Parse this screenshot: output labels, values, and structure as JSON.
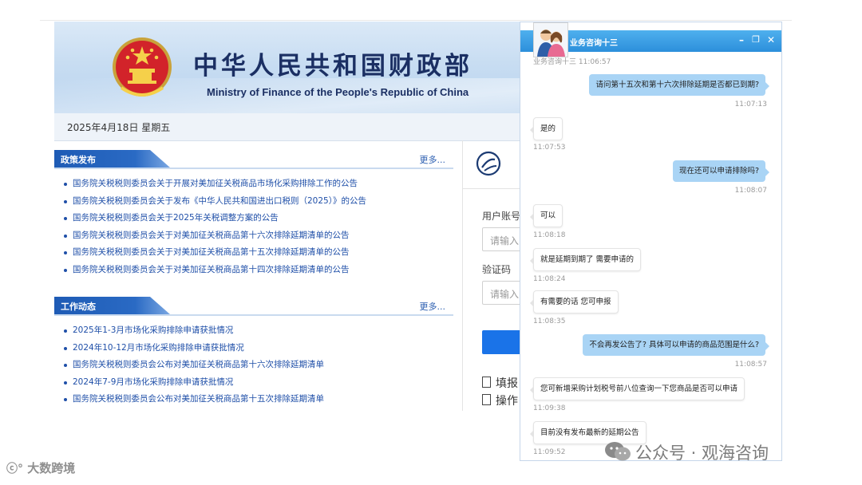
{
  "site": {
    "title_cn": "中华人民共和国财政部",
    "title_en": "Ministry of Finance of the People's Republic of China",
    "date": "2025年4月18日 星期五",
    "policy": {
      "title": "政策发布",
      "more": "更多...",
      "items": [
        "国务院关税税则委员会关于开展对美加征关税商品市场化采购排除工作的公告",
        "国务院关税税则委员会关于发布《中华人民共和国进出口税则（2025）》的公告",
        "国务院关税税则委员会关于2025年关税调整方案的公告",
        "国务院关税税则委员会关于对美加征关税商品第十六次排除延期清单的公告",
        "国务院关税税则委员会关于对美加征关税商品第十五次排除延期清单的公告",
        "国务院关税税则委员会关于对美加征关税商品第十四次排除延期清单的公告"
      ]
    },
    "work": {
      "title": "工作动态",
      "more": "更多...",
      "items": [
        "2025年1-3月市场化采购排除申请获批情况",
        "2024年10-12月市场化采购排除申请获批情况",
        "国务院关税税则委员会公布对美加征关税商品第十六次排除延期清单",
        "2024年7-9月市场化采购排除申请获批情况",
        "国务院关税税则委员会公布对美加征关税商品第十五次排除延期清单"
      ]
    },
    "login": {
      "account_label": "用户账号",
      "account_placeholder": "请输入",
      "captcha_label": "验证码",
      "captcha_placeholder": "请输入",
      "link1": "填报",
      "link2": "操作"
    }
  },
  "chat": {
    "title": "业务咨询十三",
    "controls": {
      "minimize": "–",
      "restore": "❐",
      "close": "✕"
    },
    "messages": [
      {
        "dir": "in",
        "sender": "业务咨询十三",
        "time": "11:06:57",
        "text": ""
      },
      {
        "dir": "out",
        "time": "11:07:13",
        "text": "请问第十五次和第十六次排除延期是否都已到期?"
      },
      {
        "dir": "in",
        "time": "11:07:53",
        "text": "是的"
      },
      {
        "dir": "out",
        "time": "11:08:07",
        "text": "现在还可以申请排除吗?"
      },
      {
        "dir": "in",
        "time": "11:08:18",
        "text": "可以"
      },
      {
        "dir": "in",
        "time": "11:08:24",
        "text": "就是延期到期了 需要申请的"
      },
      {
        "dir": "in",
        "time": "11:08:35",
        "text": "有需要的话 您可申报"
      },
      {
        "dir": "out",
        "time": "11:08:57",
        "text": "不会再发公告了? 具体可以申请的商品范围是什么?"
      },
      {
        "dir": "in",
        "time": "11:09:38",
        "text": "您可新增采购计划税号前八位查询一下您商品是否可以申请"
      },
      {
        "dir": "in",
        "time": "11:09:52",
        "text": "目前没有发布最新的延期公告"
      }
    ]
  },
  "watermarks": {
    "left": "大数跨境",
    "right": "公众号 · 观海咨询"
  },
  "colors": {
    "banner_blue": "#1b2f63",
    "section_tab": "#1e5bb5",
    "link": "#1f4fa8",
    "chat_header": "#2c8fdb",
    "out_bubble": "#a9d4f5",
    "login_button": "#1a73e8"
  }
}
